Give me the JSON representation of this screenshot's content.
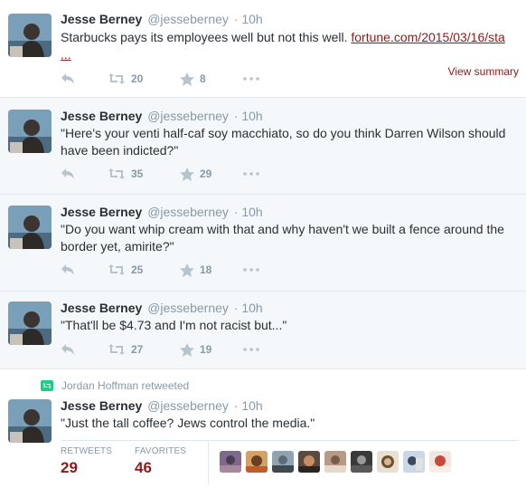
{
  "tweets": [
    {
      "name": "Jesse Berney",
      "handle": "@jesseberney",
      "time": "· 10h",
      "text": "Starbucks pays its employees well but not this well. ",
      "link": "fortune.com/2015/03/16/sta",
      "link_more": "...",
      "retweets": "20",
      "favorites": "8",
      "summary_label": "View summary"
    },
    {
      "name": "Jesse Berney",
      "handle": "@jesseberney",
      "time": "· 10h",
      "text": "\"Here's your venti half-caf soy macchiato, so do you think Darren Wilson should have been indicted?\"",
      "retweets": "35",
      "favorites": "29"
    },
    {
      "name": "Jesse Berney",
      "handle": "@jesseberney",
      "time": "· 10h",
      "text": "\"Do you want whip cream with that and why haven't we built a fence around the border yet, amirite?\"",
      "retweets": "25",
      "favorites": "18"
    },
    {
      "name": "Jesse Berney",
      "handle": "@jesseberney",
      "time": "· 10h",
      "text": "\"That'll be $4.73 and I'm not racist but...\"",
      "retweets": "27",
      "favorites": "19"
    },
    {
      "retweeted_by": "Jordan Hoffman retweeted",
      "name": "Jesse Berney",
      "handle": "@jesseberney",
      "time": "· 10h",
      "text": "\"Just the tall coffee? Jews control the media.\"",
      "stats": {
        "retweets_label": "RETWEETS",
        "retweets_value": "29",
        "favorites_label": "FAVORITES",
        "favorites_value": "46"
      }
    }
  ],
  "icons": {
    "reply": "reply-icon",
    "retweet": "retweet-icon",
    "favorite": "star-icon",
    "more": "more-icon"
  },
  "colors": {
    "link": "#8b1a1a",
    "muted": "#8899a6",
    "retweet_badge": "#19cf86"
  }
}
